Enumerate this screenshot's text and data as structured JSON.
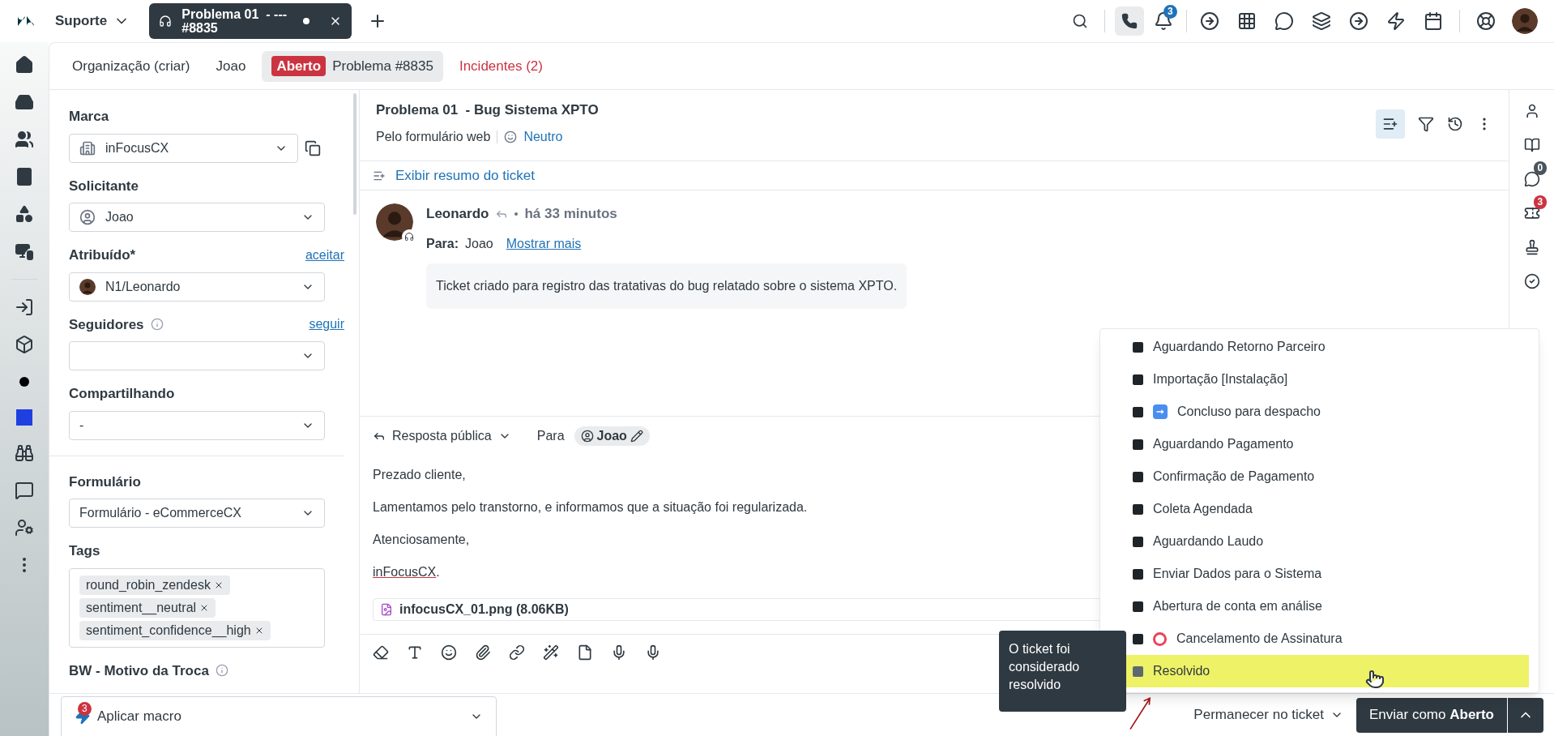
{
  "topbar": {
    "product": "Suporte",
    "open_tab": {
      "title": "Problema 01  - ---",
      "subtitle": "#8835"
    },
    "notification_count": "3"
  },
  "ticket_tabs": [
    {
      "kind": "plain",
      "label": "Organização (criar)",
      "selected": false
    },
    {
      "kind": "plain",
      "label": "Joao",
      "selected": false
    },
    {
      "kind": "status",
      "badge": "Aberto",
      "label": "Problema #8835",
      "selected": true
    },
    {
      "kind": "alert",
      "label": "Incidentes (2)",
      "selected": false
    }
  ],
  "fields": [
    {
      "kind": "brand",
      "label": "Marca",
      "value": "inFocusCX",
      "copy": true
    },
    {
      "kind": "requester",
      "label": "Solicitante",
      "value": "Joao"
    },
    {
      "kind": "assignee",
      "label": "Atribuído*",
      "value": "N1/Leonardo",
      "action": "aceitar"
    },
    {
      "kind": "select",
      "label": "Seguidores",
      "info": true,
      "action": "seguir"
    },
    {
      "kind": "select",
      "label": "Compartilhando",
      "value": "-"
    },
    {
      "kind": "divider"
    },
    {
      "kind": "select",
      "label": "Formulário",
      "value": "Formulário - eCommerceCX"
    },
    {
      "kind": "tags",
      "label": "Tags",
      "tags": [
        "round_robin_zendesk",
        "sentiment__neutral",
        "sentiment_confidence__high"
      ]
    },
    {
      "kind": "label",
      "label": "BW - Motivo da Troca",
      "info": true
    }
  ],
  "ticket": {
    "title": "Problema 01  - Bug Sistema XPTO",
    "channel": "Pelo formulário web",
    "sentiment": "Neutro",
    "summary_link": "Exibir resumo do ticket"
  },
  "message": {
    "author": "Leonardo",
    "time": "há 33 minutos",
    "to_label": "Para:",
    "to": "Joao",
    "more_link": "Mostrar mais",
    "body": "Ticket criado para registro das tratativas do bug relatado sobre o sistema XPTO."
  },
  "composer": {
    "mode": "Resposta pública",
    "to_label": "Para",
    "recipient": "Joao",
    "paragraphs": [
      "Prezado cliente,",
      "Lamentamos pelo transtorno, e informamos que a situação foi regularizada.",
      "Atenciosamente,"
    ],
    "signature": "inFocusCX",
    "signature_end": ".",
    "attachment": "infocusCX_01.png (8.06KB)"
  },
  "right_rail": {
    "chat_count": "0",
    "ticket_count": "3"
  },
  "status_menu": [
    {
      "kind": "plain",
      "label": "Aguardando Retorno Parceiro",
      "selected": false
    },
    {
      "kind": "plain",
      "label": "Importação [Instalação]",
      "selected": false
    },
    {
      "kind": "arrow",
      "label": "Concluso para despacho",
      "selected": false
    },
    {
      "kind": "plain",
      "label": "Aguardando Pagamento",
      "selected": false
    },
    {
      "kind": "plain",
      "label": "Confirmação de Pagamento",
      "selected": false
    },
    {
      "kind": "plain",
      "label": "Coleta Agendada",
      "selected": false
    },
    {
      "kind": "plain",
      "label": "Aguardando Laudo",
      "selected": false
    },
    {
      "kind": "plain",
      "label": "Enviar Dados para o Sistema",
      "selected": false
    },
    {
      "kind": "plain",
      "label": "Abertura de conta em análise",
      "selected": false
    },
    {
      "kind": "ring",
      "label": "Cancelamento de Assinatura",
      "selected": false
    },
    {
      "kind": "plain",
      "label": "Resolvido",
      "selected": true
    }
  ],
  "tooltip": "O ticket foi considerado resolvido",
  "footer": {
    "macro": "Aplicar macro",
    "macro_count": "3",
    "stay": "Permanecer no ticket",
    "submit_prefix": "Enviar como",
    "submit_status": "Aberto"
  }
}
